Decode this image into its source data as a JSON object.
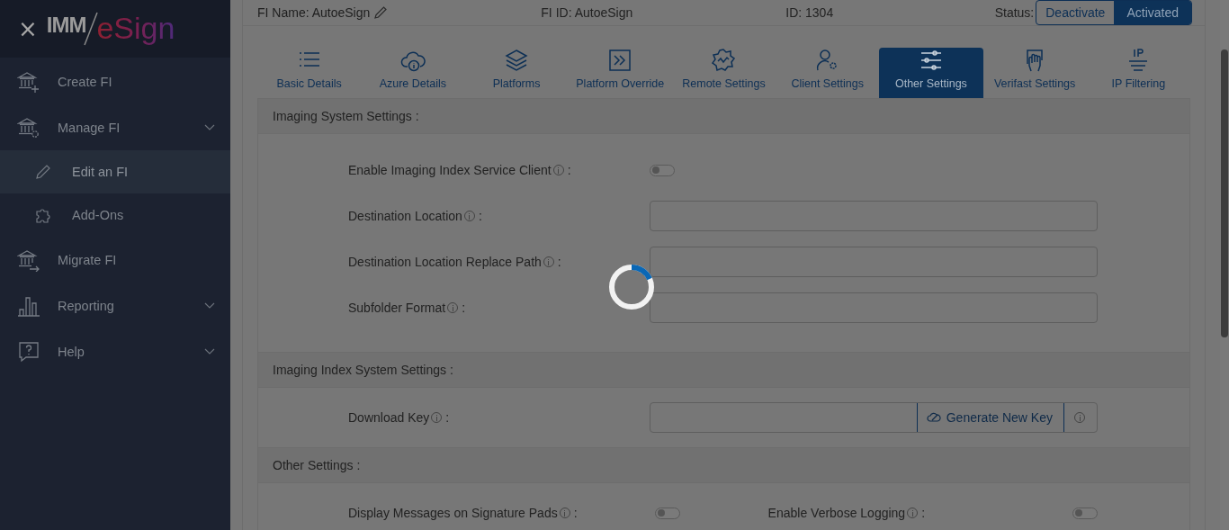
{
  "sidebar": {
    "close": "×",
    "logo": {
      "prefix": "IMM",
      "suffix": "eSign"
    },
    "items": [
      {
        "label": "Create FI",
        "has_submenu": false,
        "selected": false
      },
      {
        "label": "Manage FI",
        "has_submenu": true,
        "selected": false,
        "children": [
          {
            "label": "Edit an FI",
            "selected": true
          },
          {
            "label": "Add-Ons",
            "selected": false
          }
        ]
      },
      {
        "label": "Migrate FI",
        "has_submenu": false,
        "selected": false
      },
      {
        "label": "Reporting",
        "has_submenu": true,
        "selected": false
      },
      {
        "label": "Help",
        "has_submenu": true,
        "selected": false
      }
    ]
  },
  "header": {
    "fi_name": "FI Name: AutoeSign",
    "fi_id": "FI ID: AutoeSign",
    "id": "ID: 1304",
    "status_label": "Status:",
    "status_options": [
      {
        "label": "Deactivate",
        "selected": false
      },
      {
        "label": "Activated",
        "selected": true
      }
    ]
  },
  "tabs": [
    {
      "label": "Basic Details",
      "selected": false
    },
    {
      "label": "Azure Details",
      "selected": false
    },
    {
      "label": "Platforms",
      "selected": false
    },
    {
      "label": "Platform Override",
      "selected": false
    },
    {
      "label": "Remote Settings",
      "selected": false
    },
    {
      "label": "Client Settings",
      "selected": false
    },
    {
      "label": "Other Settings",
      "selected": true
    },
    {
      "label": "Verifast Settings",
      "selected": false
    },
    {
      "label": "IP Filtering",
      "selected": false
    }
  ],
  "sections": [
    {
      "title": "Imaging System Settings :",
      "rows": [
        {
          "kind": "toggle",
          "label": "Enable Imaging Index Service Client",
          "suffix": ":",
          "on": false
        },
        {
          "kind": "text",
          "label": "Destination Location",
          "suffix": ":"
        },
        {
          "kind": "text",
          "label": "Destination Location Replace Path",
          "suffix": ":"
        },
        {
          "kind": "text",
          "label": "Subfolder Format",
          "suffix": ":"
        }
      ]
    },
    {
      "title": "Imaging Index System Settings :",
      "rows": [
        {
          "kind": "key",
          "label": "Download Key",
          "suffix": ":",
          "button": "Generate New Key"
        }
      ]
    },
    {
      "title": "Other Settings :",
      "rows": [
        {
          "kind": "pair",
          "items": [
            {
              "label": "Display Messages on Signature Pads",
              "suffix": ":",
              "on": false
            },
            {
              "label": "Enable Verbose Logging",
              "suffix": ":",
              "on": false
            }
          ]
        }
      ]
    }
  ],
  "loading": true
}
